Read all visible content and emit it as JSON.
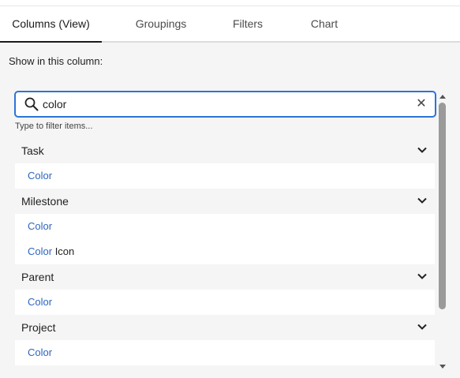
{
  "tabs": [
    {
      "label": "Columns (View)",
      "active": true
    },
    {
      "label": "Groupings",
      "active": false
    },
    {
      "label": "Filters",
      "active": false
    },
    {
      "label": "Chart",
      "active": false
    }
  ],
  "panel": {
    "heading": "Show in this column:",
    "search": {
      "value": "color",
      "icon": "search-icon",
      "clear_icon": "close-icon",
      "clear_glyph": "✕"
    },
    "hint": "Type to filter items..."
  },
  "groups": [
    {
      "label": "Task",
      "items": [
        {
          "highlight": "Color",
          "rest": ""
        }
      ]
    },
    {
      "label": "Milestone",
      "items": [
        {
          "highlight": "Color",
          "rest": ""
        },
        {
          "highlight": "Color",
          "rest": " Icon"
        }
      ]
    },
    {
      "label": "Parent",
      "items": [
        {
          "highlight": "Color",
          "rest": ""
        }
      ]
    },
    {
      "label": "Project",
      "items": [
        {
          "highlight": "Color",
          "rest": ""
        }
      ]
    }
  ],
  "colors": {
    "accent": "#2c74d6",
    "highlight_text": "#2d66bf",
    "panel_bg": "#f5f5f5"
  }
}
